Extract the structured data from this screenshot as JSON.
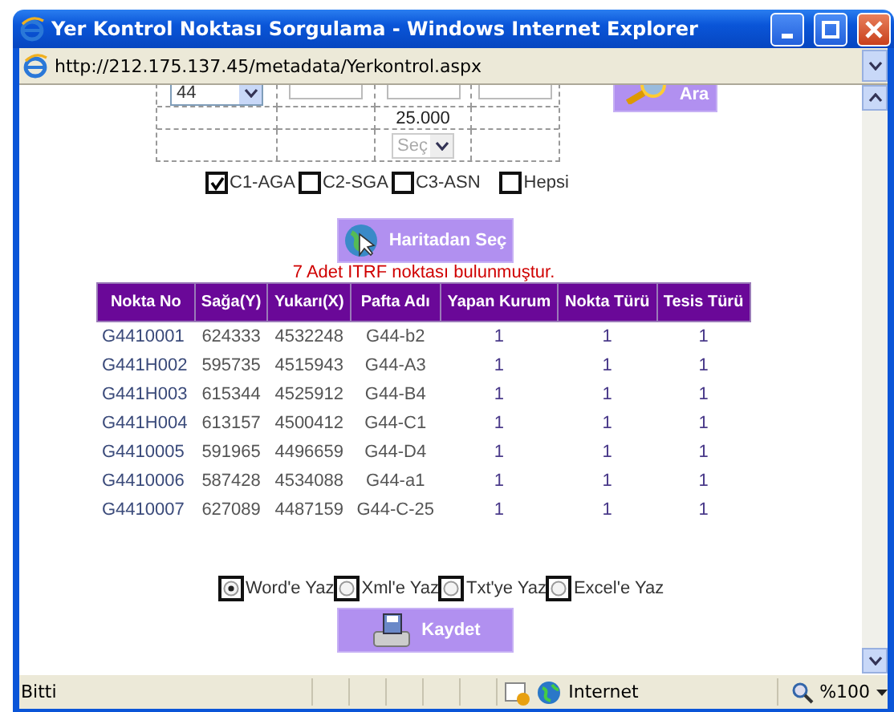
{
  "window": {
    "title": "Yer Kontrol Noktası Sorgulama - Windows Internet Explorer",
    "address": "http://212.175.137.45/metadata/Yerkontrol.aspx"
  },
  "form": {
    "sheet_select": "44",
    "scale": "25.000",
    "scale_select": {
      "value": "Seç",
      "disabled": true
    },
    "search_button": "Ara"
  },
  "classes": [
    {
      "label": "C1-AGA",
      "checked": true
    },
    {
      "label": "C2-SGA",
      "checked": false
    },
    {
      "label": "C3-ASN",
      "checked": false
    },
    {
      "label": "Hepsi",
      "checked": false
    }
  ],
  "map_button": "Haritadan Seç",
  "message": "7 Adet ITRF noktası bulunmuştur.",
  "table": {
    "columns": [
      "Nokta No",
      "Sağa(Y)",
      "Yukarı(X)",
      "Pafta Adı",
      "Yapan Kurum",
      "Nokta Türü",
      "Tesis Türü"
    ],
    "rows": [
      [
        "G4410001",
        "624333",
        "4532248",
        "G44-b2",
        "1",
        "1",
        "1"
      ],
      [
        "G441H002",
        "595735",
        "4515943",
        "G44-A3",
        "1",
        "1",
        "1"
      ],
      [
        "G441H003",
        "615344",
        "4525912",
        "G44-B4",
        "1",
        "1",
        "1"
      ],
      [
        "G441H004",
        "613157",
        "4500412",
        "G44-C1",
        "1",
        "1",
        "1"
      ],
      [
        "G4410005",
        "591965",
        "4496659",
        "G44-D4",
        "1",
        "1",
        "1"
      ],
      [
        "G4410006",
        "587428",
        "4534088",
        "G44-a1",
        "1",
        "1",
        "1"
      ],
      [
        "G4410007",
        "627089",
        "4487159",
        "G44-C-25",
        "1",
        "1",
        "1"
      ]
    ]
  },
  "export": {
    "options": [
      {
        "label": "Word'e Yaz",
        "selected": true
      },
      {
        "label": "Xml'e Yaz",
        "selected": false
      },
      {
        "label": "Txt'ye Yaz",
        "selected": false
      },
      {
        "label": "Excel'e Yaz",
        "selected": false
      }
    ],
    "save_button": "Kaydet"
  },
  "status_bar": {
    "text": "Bitti",
    "zone": "Internet",
    "zoom": "%100"
  }
}
